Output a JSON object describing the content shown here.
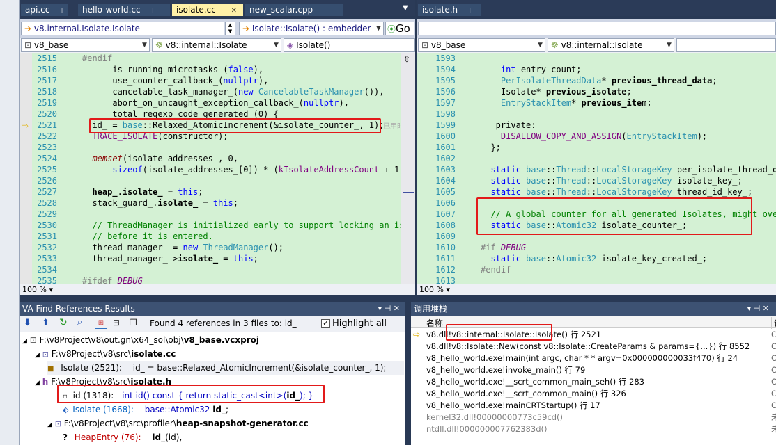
{
  "left_editor": {
    "tabs": [
      {
        "label": "api.cc"
      },
      {
        "label": "hello-world.cc"
      },
      {
        "label": "isolate.cc"
      },
      {
        "label": "new_scalar.cpp"
      }
    ],
    "nav_combo_left": "v8.internal.Isolate.Isolate",
    "nav_combo_right": "Isolate::Isolate() : embedder",
    "go_label": "Go",
    "scope_project": "v8_base",
    "scope_class": "v8::internal::Isolate",
    "scope_member": "Isolate()",
    "zoom": "100 %",
    "inline_hint": "已用时",
    "lines": [
      {
        "n": "2515",
        "t": "#endif"
      },
      {
        "n": "2516",
        "t": "      is_running_microtasks_(false),"
      },
      {
        "n": "2517",
        "t": "      use_counter_callback_(nullptr),"
      },
      {
        "n": "2518",
        "t": "      cancelable_task_manager_(new CancelableTaskManager()),"
      },
      {
        "n": "2519",
        "t": "      abort_on_uncaught_exception_callback_(nullptr),"
      },
      {
        "n": "2520",
        "t": "      total_regexp_code_generated_(0) {"
      },
      {
        "n": "2521",
        "t": "  id_ = base::Relaxed_AtomicIncrement(&isolate_counter_, 1);"
      },
      {
        "n": "2522",
        "t": "  TRACE_ISOLATE(constructor);"
      },
      {
        "n": "2523",
        "t": ""
      },
      {
        "n": "2524",
        "t": "  memset(isolate_addresses_, 0,"
      },
      {
        "n": "2525",
        "t": "      sizeof(isolate_addresses_[0]) * (kIsolateAddressCount + 1));"
      },
      {
        "n": "2526",
        "t": ""
      },
      {
        "n": "2527",
        "t": "  heap_.isolate_ = this;"
      },
      {
        "n": "2528",
        "t": "  stack_guard_.isolate_ = this;"
      },
      {
        "n": "2529",
        "t": ""
      },
      {
        "n": "2530",
        "t": "  // ThreadManager is initialized early to support locking an iso"
      },
      {
        "n": "2531",
        "t": "  // before it is entered."
      },
      {
        "n": "2532",
        "t": "  thread_manager_ = new ThreadManager();"
      },
      {
        "n": "2533",
        "t": "  thread_manager_->isolate_ = this;"
      },
      {
        "n": "2534",
        "t": ""
      },
      {
        "n": "2535",
        "t": "#ifdef DEBUG"
      }
    ]
  },
  "right_editor": {
    "tab": "isolate.h",
    "scope_project": "v8_base",
    "scope_class": "v8::internal::Isolate",
    "zoom": "100 %",
    "lines": [
      {
        "n": "1593",
        "t": ""
      },
      {
        "n": "1594",
        "t": "    int entry_count;"
      },
      {
        "n": "1595",
        "t": "    PerIsolateThreadData* previous_thread_data;"
      },
      {
        "n": "1596",
        "t": "    Isolate* previous_isolate;"
      },
      {
        "n": "1597",
        "t": "    EntryStackItem* previous_item;"
      },
      {
        "n": "1598",
        "t": ""
      },
      {
        "n": "1599",
        "t": "   private:"
      },
      {
        "n": "1600",
        "t": "    DISALLOW_COPY_AND_ASSIGN(EntryStackItem);"
      },
      {
        "n": "1601",
        "t": "  };"
      },
      {
        "n": "1602",
        "t": ""
      },
      {
        "n": "1603",
        "t": "  static base::Thread::LocalStorageKey per_isolate_thread_dat"
      },
      {
        "n": "1604",
        "t": "  static base::Thread::LocalStorageKey isolate_key_;"
      },
      {
        "n": "1605",
        "t": "  static base::Thread::LocalStorageKey thread_id_key_;"
      },
      {
        "n": "1606",
        "t": ""
      },
      {
        "n": "1607",
        "t": "  // A global counter for all generated Isolates, might overf"
      },
      {
        "n": "1608",
        "t": "  static base::Atomic32 isolate_counter_;"
      },
      {
        "n": "1609",
        "t": ""
      },
      {
        "n": "1610",
        "t": "#if DEBUG"
      },
      {
        "n": "1611",
        "t": "  static base::Atomic32 isolate_key_created_;"
      },
      {
        "n": "1612",
        "t": "#endif"
      },
      {
        "n": "1613",
        "t": ""
      }
    ]
  },
  "find_refs": {
    "title": "VA Find References Results",
    "summary": "Found 4 references in 3 files to: id_",
    "highlight_all": "Highlight all",
    "rows": [
      {
        "text": "F:\\v8Project\\v8\\out.gn\\x64_sol\\obj\\",
        "bold": "v8_base.vcxproj"
      },
      {
        "text": "F:\\v8Project\\v8\\src\\",
        "bold": "isolate.cc"
      },
      {
        "ref": "Isolate (2521):",
        "code": "id_ = base::Relaxed_AtomicIncrement(&isolate_counter_, 1);"
      },
      {
        "text": "F:\\v8Project\\v8\\src\\",
        "bold": "isolate.h"
      },
      {
        "ref": "id (1318):",
        "code_a": "int id() const { return static_cast<int>(",
        "code_b": "id_",
        "code_c": "); }"
      },
      {
        "ref": "Isolate (1668):",
        "code_a": "base::Atomic32 ",
        "code_b": "id_",
        "code_c": ";"
      },
      {
        "text": "F:\\v8Project\\v8\\src\\profiler\\",
        "bold": "heap-snapshot-generator.cc"
      },
      {
        "ref": "HeapEntry (76):",
        "code_a": "",
        "code_b": "id_",
        "code_c": "(id),"
      }
    ]
  },
  "callstack": {
    "title": "调用堆栈",
    "col_name": "名称",
    "col_lang": "语",
    "rows": [
      {
        "pre": "v8.dll!",
        "mid": "v8::internal::Isolate::Isolate()",
        "post": " 行 2521",
        "gray": false
      },
      {
        "pre": "v8.dll!v8::Isolate::New(const v8::Isolate::CreateParams & params={...}) 行 8552",
        "mid": "",
        "post": "",
        "gray": false
      },
      {
        "pre": "v8_hello_world.exe!main(int argc, char * * argv=0x000000000033f470) 行 24",
        "mid": "",
        "post": "",
        "gray": false
      },
      {
        "pre": "v8_hello_world.exe!invoke_main() 行 79",
        "mid": "",
        "post": "",
        "gray": false
      },
      {
        "pre": "v8_hello_world.exe!__scrt_common_main_seh() 行 283",
        "mid": "",
        "post": "",
        "gray": false
      },
      {
        "pre": "v8_hello_world.exe!__scrt_common_main() 行 326",
        "mid": "",
        "post": "",
        "gray": false
      },
      {
        "pre": "v8_hello_world.exe!mainCRTStartup() 行 17",
        "mid": "",
        "post": "",
        "gray": false
      },
      {
        "pre": "kernel32.dll!00000000773c59cd()",
        "mid": "",
        "post": "",
        "gray": true
      },
      {
        "pre": "ntdll.dll!000000007762383d()",
        "mid": "",
        "post": "",
        "gray": true
      }
    ]
  }
}
